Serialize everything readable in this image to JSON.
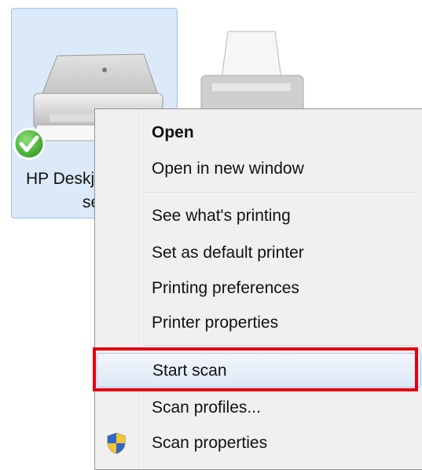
{
  "printers": [
    {
      "name_line1": "HP Deskj",
      "name_line2": "ser",
      "status": "default-printer-check",
      "selected": true,
      "icon": "printer-icon"
    },
    {
      "icon": "printer-icon"
    }
  ],
  "context_menu": {
    "items": [
      {
        "label": "Open",
        "bold": true
      },
      {
        "label": "Open in new window"
      },
      {
        "label": "See what's printing"
      },
      {
        "label": "Set as default printer"
      },
      {
        "label": "Printing preferences"
      },
      {
        "label": "Printer properties"
      },
      {
        "label": "Start scan",
        "hovered": true,
        "highlighted": true
      },
      {
        "label": "Scan profiles..."
      },
      {
        "label": "Scan properties",
        "icon": "shield-icon"
      }
    ]
  },
  "colors": {
    "highlight_border": "#e3000f",
    "tile_background": "#dbe9f8",
    "menu_background": "#f0f0f0"
  }
}
